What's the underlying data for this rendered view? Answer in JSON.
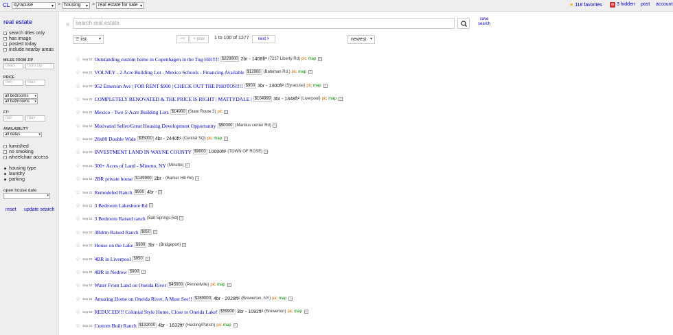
{
  "header": {
    "logo": "CL",
    "city": "syracuse",
    "section": "housing",
    "category": "real estate for sale",
    "sep": ">",
    "favorites": "118 favorites",
    "hidden": "3 hidden",
    "post": "post",
    "account": "account"
  },
  "sidebar": {
    "title": "real estate",
    "checks": [
      "search titles only",
      "has image",
      "posted today",
      "include nearby areas"
    ],
    "miles_label": "MILES FROM ZIP",
    "miles_placeholder": "miles",
    "zip_placeholder": "from zip",
    "price_label": "PRICE",
    "min_placeholder": "min",
    "max_placeholder": "max",
    "bedrooms": "all bedrooms",
    "bathrooms": "all bathrooms",
    "ft_label": "FT²",
    "availability_label": "AVAILABILITY",
    "availability": "all dates",
    "checks2": [
      "furnished",
      "no smoking",
      "wheelchair access"
    ],
    "bullets": [
      "housing type",
      "laundry",
      "parking"
    ],
    "open_house": "open house date",
    "reset": "reset",
    "update": "update search"
  },
  "search": {
    "placeholder": "search real estate",
    "save_line1": "save",
    "save_line2": "search"
  },
  "toolbar": {
    "view": "list",
    "first": "<<",
    "prev": "< prev",
    "range": "1 to 100 of 1277",
    "next": "next >",
    "sort": "newest"
  },
  "listings": [
    {
      "date": "Sep 22",
      "title": "Outstanding custom home in Copenhagen in the Tug Hill!!!!",
      "price": "$229900",
      "housing": "2br - 1408ft²",
      "hood": "(7237 Liberty Rd)",
      "pic": "pic",
      "map": "map"
    },
    {
      "date": "Sep 22",
      "title": "VOLNEY - 2 Acre Building Lot - Mexico Schools - Financing Available",
      "price": "$12900",
      "housing": "",
      "hood": "(Bateman Rd.)",
      "pic": "pic",
      "map": "map"
    },
    {
      "date": "Sep 22",
      "title": "952 Emerson Ave | FOR RENT $900 | CHECK OUT THE PHOTOS!!!!",
      "price": "$900",
      "housing": "3br - 1300ft²",
      "hood": "(Syracuse)",
      "pic": "pic",
      "map": "map"
    },
    {
      "date": "Sep 22",
      "title": "COMPLETELY RENOVATED & THE PRICE IS RIGHT | MATTYDALE |",
      "price": "$104999",
      "housing": "3br - 1348ft²",
      "hood": "(Liverpool)",
      "pic": "pic",
      "map": "map"
    },
    {
      "date": "Sep 22",
      "title": "Mexico - Two 5-Acre Building Lots",
      "price": "$14900",
      "housing": "",
      "hood": "(State Route 3)",
      "pic": "pic",
      "map": ""
    },
    {
      "date": "Sep 22",
      "title": "Motivated Seller/Great Housing Development Opportunity",
      "price": "$90000",
      "housing": "",
      "hood": "(Manlius center Rd)",
      "pic": "",
      "map": ""
    },
    {
      "date": "Sep 22",
      "title": "28x80 Double Wide",
      "price": "$35000",
      "housing": "4br - 2440ft²",
      "hood": "(Central SQ)",
      "pic": "pic",
      "map": "map"
    },
    {
      "date": "Sep 22",
      "title": "INVESTMENT LAND IN WAYNE COUNTY",
      "price": "$9000",
      "housing": "10000ft²",
      "hood": "(TOWN OF ROSE)",
      "pic": "",
      "map": ""
    },
    {
      "date": "Sep 22",
      "title": "300+ Acres of Land - Minetto, NY",
      "price": "",
      "housing": "",
      "hood": "(Minetto)",
      "pic": "",
      "map": ""
    },
    {
      "date": "Sep 22",
      "title": "2BR private house",
      "price": "$149900",
      "housing": "2br -",
      "hood": "(Barker Hill Rd)",
      "pic": "",
      "map": ""
    },
    {
      "date": "Sep 22",
      "title": "Remodeled Ranch",
      "price": "$900",
      "housing": "4br -",
      "hood": "",
      "pic": "",
      "map": ""
    },
    {
      "date": "Sep 22",
      "title": "3 Bedroom Lakeshore Rd",
      "price": "",
      "housing": "",
      "hood": "",
      "pic": "",
      "map": ""
    },
    {
      "date": "Sep 22",
      "title": "3 Bedroom Raised ranch",
      "price": "",
      "housing": "",
      "hood": "(Salt Springs Rd)",
      "pic": "",
      "map": ""
    },
    {
      "date": "Sep 22",
      "title": "3Bdrm Raised Ranch",
      "price": "$850",
      "housing": "",
      "hood": "",
      "pic": "",
      "map": ""
    },
    {
      "date": "Sep 22",
      "title": "House on the Lake",
      "price": "$900",
      "housing": "3br -",
      "hood": "(Bridgeport)",
      "pic": "",
      "map": ""
    },
    {
      "date": "Sep 22",
      "title": "4BR in Liverpool",
      "price": "$950",
      "housing": "",
      "hood": "",
      "pic": "",
      "map": ""
    },
    {
      "date": "Sep 22",
      "title": "4BR in Nedrow",
      "price": "$900",
      "housing": "",
      "hood": "",
      "pic": "",
      "map": ""
    },
    {
      "date": "Sep 22",
      "title": "Water Front Land on Oneida River",
      "price": "$45000",
      "housing": "",
      "hood": "(Pennellville)",
      "pic": "pic",
      "map": "map"
    },
    {
      "date": "Sep 22",
      "title": "Amazing Home on Oneida River, A Must See!!",
      "price": "$269000",
      "housing": "4br - 2028ft²",
      "hood": "(Brewerton, NY)",
      "pic": "pic",
      "map": "map"
    },
    {
      "date": "Sep 22",
      "title": "REDUCED!!! Colonial Style Home, Close to Oneida Lake!",
      "price": "$59900",
      "housing": "3br - 1092ft²",
      "hood": "(Brewerton)",
      "pic": "pic",
      "map": "map"
    },
    {
      "date": "Sep 22",
      "title": "Custom Built Ranch",
      "price": "$132000",
      "housing": "4br - 1632ft²",
      "hood": "(Hasting/Parish)",
      "pic": "pic",
      "map": "map"
    }
  ]
}
